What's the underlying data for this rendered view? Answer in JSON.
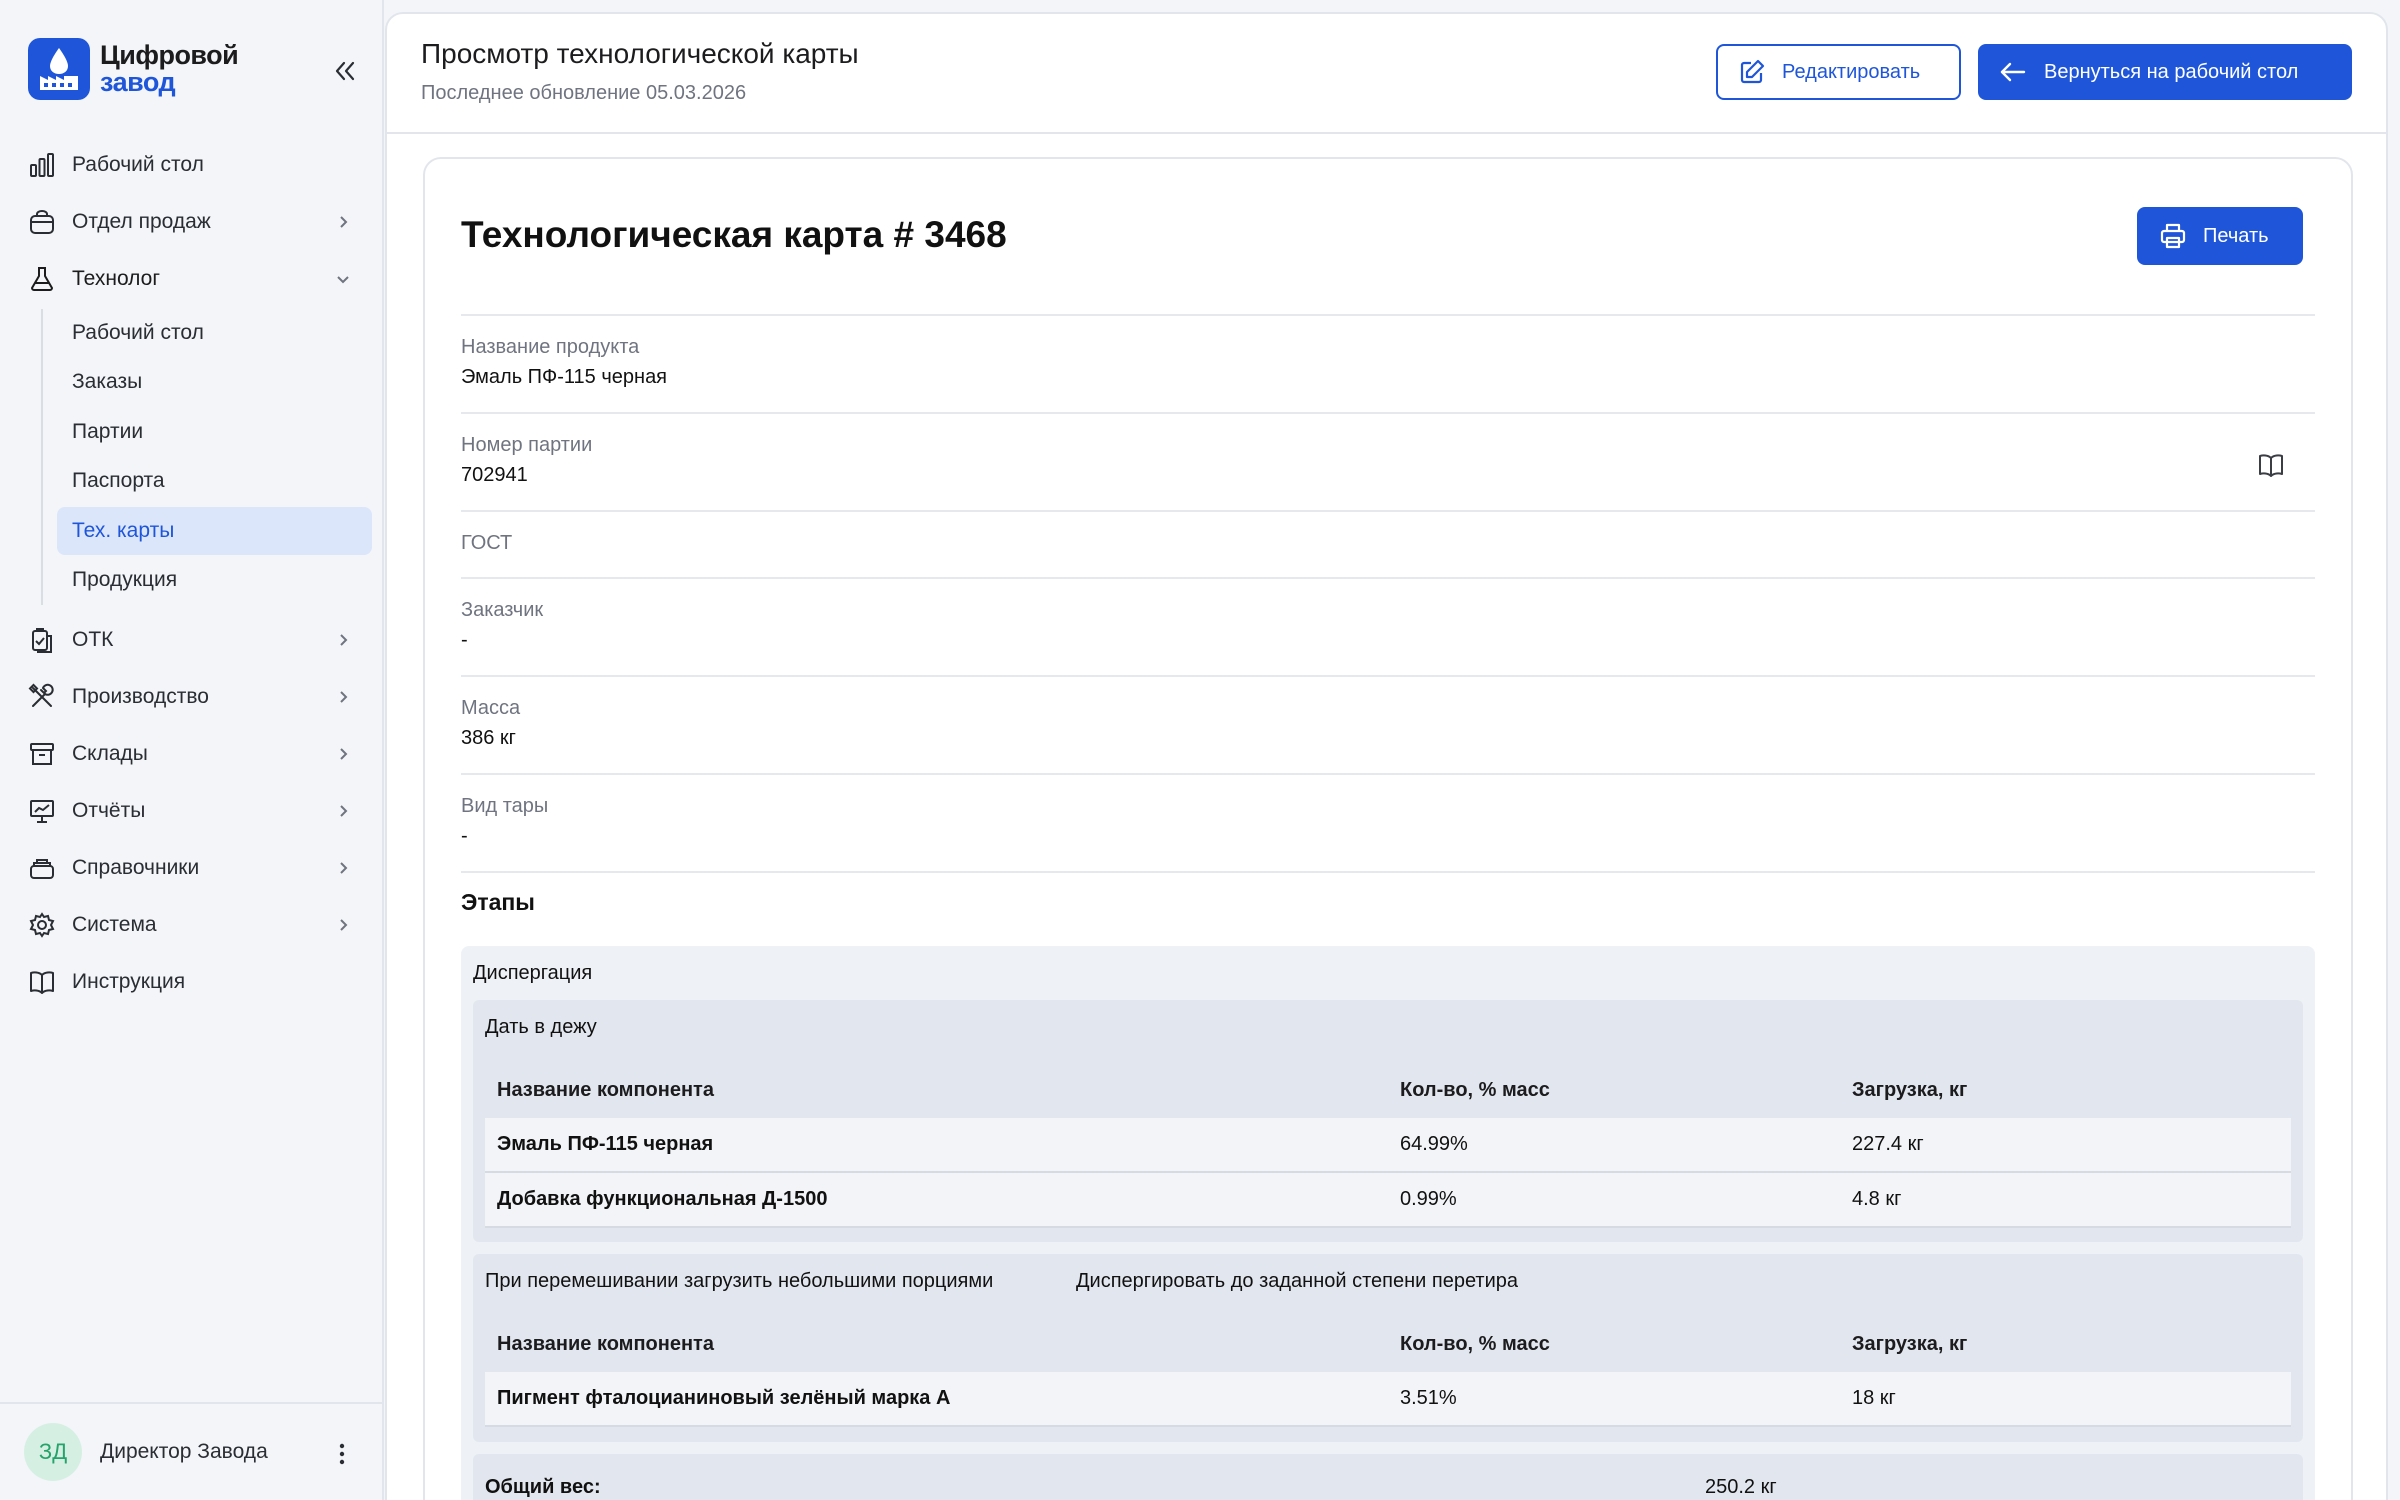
{
  "brand": {
    "line1": "Цифровой",
    "line2": "завод"
  },
  "sidebar": {
    "items": [
      {
        "label": "Рабочий стол",
        "icon": "bar-chart-icon"
      },
      {
        "label": "Отдел продаж",
        "icon": "shopping-bag-icon"
      },
      {
        "label": "Технолог",
        "icon": "flask-icon"
      },
      {
        "label": "ОТК",
        "icon": "clipboard-check-icon"
      },
      {
        "label": "Производство",
        "icon": "tools-icon"
      },
      {
        "label": "Склады",
        "icon": "archive-icon"
      },
      {
        "label": "Отчёты",
        "icon": "presentation-chart-icon"
      },
      {
        "label": "Справочники",
        "icon": "layers-icon"
      },
      {
        "label": "Система",
        "icon": "gear-icon"
      },
      {
        "label": "Инструкция",
        "icon": "book-icon"
      }
    ],
    "technolog_sub": [
      "Рабочий стол",
      "Заказы",
      "Партии",
      "Паспорта",
      "Тех. карты",
      "Продукция"
    ],
    "selected_sub": "Тех. карты"
  },
  "user": {
    "initials": "ЗД",
    "name": "Директор Завода"
  },
  "header": {
    "title": "Просмотр технологической карты",
    "subtitle": "Последнее обновление 05.03.2026",
    "edit_label": "Редактировать",
    "back_label": "Вернуться на рабочий стол"
  },
  "card": {
    "title": "Технологическая карта # 3468",
    "print_label": "Печать",
    "fields": {
      "product_label": "Название продукта",
      "product_value": "Эмаль ПФ-115 черная",
      "batch_label": "Номер партии",
      "batch_value": "702941",
      "gost_label": "ГОСТ",
      "customer_label": "Заказчик",
      "customer_value": "-",
      "mass_label": "Масса",
      "mass_value": "386 кг",
      "tare_label": "Вид тары",
      "tare_value": "-"
    },
    "stages_title": "Этапы"
  },
  "stage": {
    "name": "Диспергация",
    "columns": [
      "Название компонента",
      "Кол-во, % масс",
      "Загрузка, кг"
    ],
    "steps": [
      {
        "name": "Дать в дежу",
        "rows": [
          {
            "name": "Эмаль ПФ-115 черная",
            "percent": "64.99%",
            "load": "227.4 кг"
          },
          {
            "name": "Добавка функциональная Д-1500",
            "percent": "0.99%",
            "load": "4.8 кг"
          }
        ]
      },
      {
        "name": "При перемешивании загрузить небольшими порциями",
        "extra": "Диспергировать до заданной степени перетира",
        "rows": [
          {
            "name": "Пигмент фталоцианиновый зелёный марка А",
            "percent": "3.51%",
            "load": "18 кг"
          }
        ]
      }
    ],
    "total_label": "Общий вес:",
    "total_value": "250.2 кг"
  }
}
